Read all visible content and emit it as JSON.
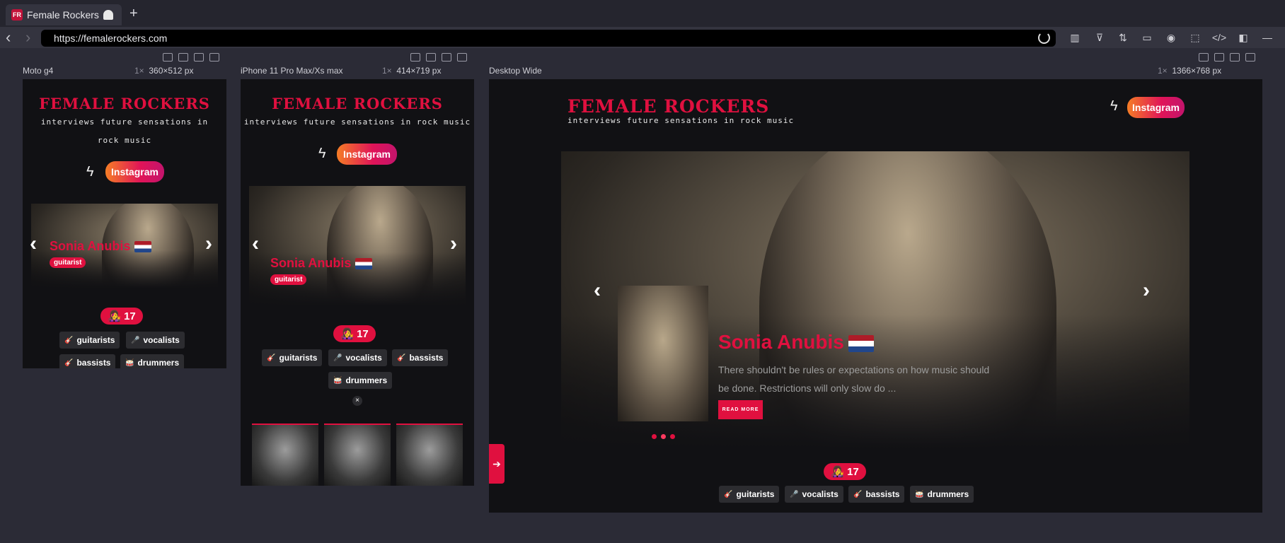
{
  "browser": {
    "tab_title": "Female Rockers",
    "favicon_text": "FR",
    "new_tab": "+",
    "url": "https://femalerockers.com"
  },
  "site": {
    "logo": "FEMALE ROCKERS",
    "tagline": "interviews future sensations in rock music",
    "instagram": "Instagram",
    "featured_name": "Sonia Anubis",
    "featured_role": "guitarist",
    "featured_excerpt": "There shouldn't be rules or expectations on how music should be done. Restrictions will only slow do ...",
    "read_more": "READ MORE",
    "count": "17",
    "categories": [
      "guitarists",
      "vocalists",
      "bassists",
      "drummers"
    ],
    "close": "×"
  },
  "devices": [
    {
      "name": "Moto g4",
      "scale": "1×",
      "size": "360×512",
      "unit": "px"
    },
    {
      "name": "iPhone 11 Pro Max/Xs max",
      "scale": "1×",
      "size": "414×719",
      "unit": "px"
    },
    {
      "name": "Desktop Wide",
      "scale": "1×",
      "size": "1366×768",
      "unit": "px"
    }
  ],
  "icons": {
    "back": "chevron-left-icon",
    "forward": "chevron-right-icon",
    "reload": "reload-icon",
    "bolt": "bolt-icon",
    "flag": "netherlands-flag-icon"
  },
  "colors": {
    "brand": "#e0103f",
    "background": "#111114",
    "chrome": "#2b2b36"
  }
}
